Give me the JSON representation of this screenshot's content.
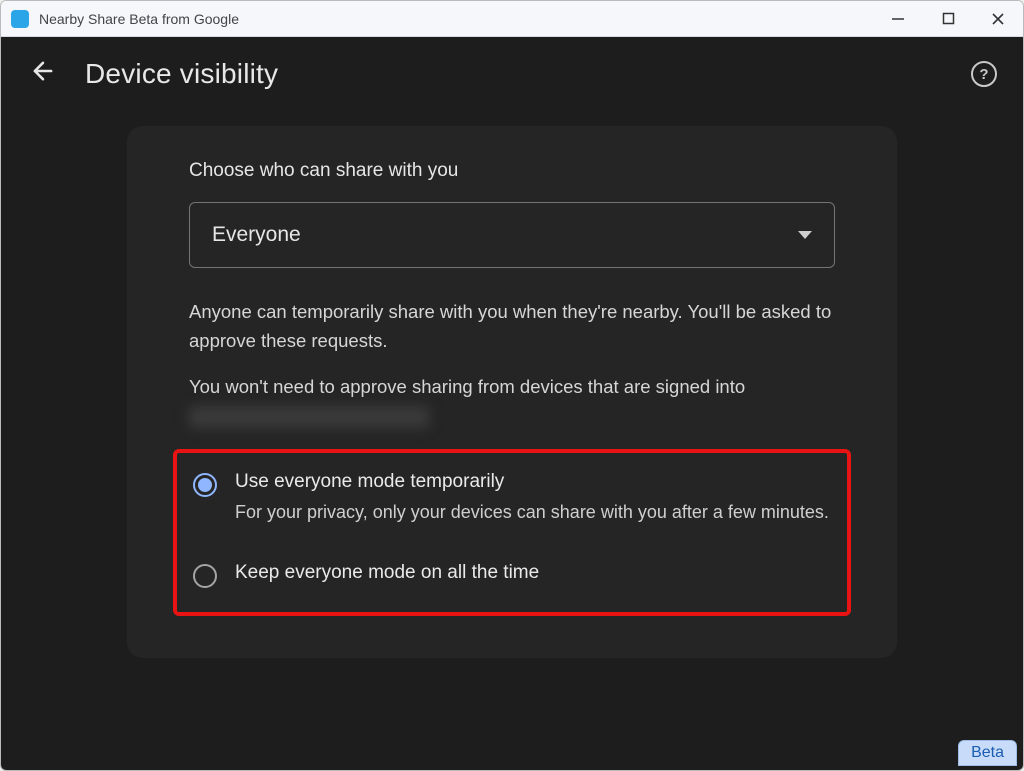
{
  "window": {
    "title": "Nearby Share Beta from Google"
  },
  "header": {
    "page_title": "Device visibility"
  },
  "card": {
    "section_label": "Choose who can share with you",
    "dropdown": {
      "selected": "Everyone"
    },
    "info_text_1": "Anyone can temporarily share with you when they're nearby. You'll be asked to approve these requests.",
    "info_text_2": "You won't need to approve sharing from devices that are signed into",
    "radio_options": [
      {
        "title": "Use everyone mode temporarily",
        "desc": "For your privacy, only your devices can share with you after a few minutes.",
        "selected": true
      },
      {
        "title": "Keep everyone mode on all the time",
        "desc": "",
        "selected": false
      }
    ]
  },
  "badge": {
    "label": "Beta"
  }
}
